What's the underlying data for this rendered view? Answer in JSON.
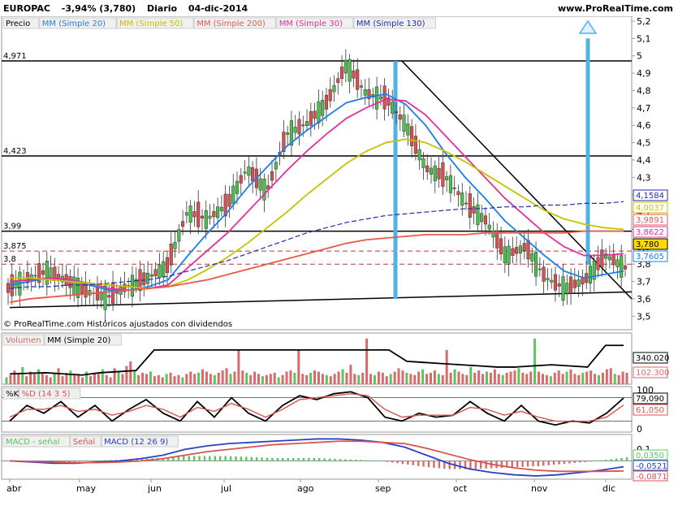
{
  "header": {
    "symbol": "EUROPAC",
    "change": "-3,94% (3,780)",
    "period": "Diario",
    "date": "04-dic-2014",
    "site": "www.ProRealTime.com"
  },
  "colors": {
    "ma20": "#1a7fe8",
    "ma50": "#c8c000",
    "ma200": "#e8594a",
    "ma30": "#e2309a",
    "ma130": "#1f2fb0",
    "volume": "#d96a6a",
    "volume_up": "#5cc45c",
    "k_line": "#000000",
    "d_line": "#d9534f",
    "macd": "#2840c8",
    "signal": "#d9534f",
    "hist_pos": "#5cc45c",
    "hist_neg": "#d96a6a",
    "blue_bar": "#4fb3e8",
    "candle_up": "#4cbf4c",
    "candle_down": "#d95050"
  },
  "price_legend": {
    "items": [
      "Precio",
      "MM (Simple 20)",
      "MM (Simple 50)",
      "MM (Simple 200)",
      "MM (Simple 30)",
      "MM (Simple 130)"
    ]
  },
  "price_note": "© ProRealTime.com Históricos ajustados con dividendos",
  "volume_legend": {
    "items": [
      "Volumen",
      "MM (Simple 20)"
    ]
  },
  "stoch_legend": {
    "items": [
      "%K",
      "%D (14 3 5)"
    ]
  },
  "macd_legend": {
    "items": [
      "MACD - señal",
      "Señal",
      "MACD (12 26 9)"
    ]
  },
  "chart_data": [
    {
      "panel": "price",
      "type": "line",
      "title": "EUROPAC",
      "x": [
        "abr",
        "may",
        "jun",
        "jul",
        "ago",
        "sep",
        "oct",
        "nov",
        "dic"
      ],
      "ylim": [
        3.45,
        5.2
      ],
      "y_ticks": [
        "5,2",
        "5,1",
        "5",
        "4,9",
        "4,8",
        "4,7",
        "4,6",
        "4,5",
        "4,4",
        "4,3",
        "4,2",
        "4,1",
        "4",
        "3,9",
        "3,8",
        "3,7",
        "3,6",
        "3,5"
      ],
      "levels": [
        {
          "label": "4,971",
          "value": 4.971
        },
        {
          "label": "4,423",
          "value": 4.423
        },
        {
          "label": "3,99",
          "value": 3.99
        },
        {
          "label": "3,875",
          "value": 3.875
        },
        {
          "label": "3,8",
          "value": 3.8
        }
      ],
      "value_tags": [
        {
          "label": "4,1584",
          "value": 4.1584,
          "series": "ma130"
        },
        {
          "label": "4,0037",
          "value": 4.0037,
          "series": "ma50"
        },
        {
          "label": "3,9891",
          "value": 3.9891,
          "series": "ma200"
        },
        {
          "label": "3,8622",
          "value": 3.8622,
          "series": "ma30"
        },
        {
          "label": "3,780",
          "value": 3.78,
          "series": "price"
        },
        {
          "label": "3,7605",
          "value": 3.7605,
          "series": "ma20"
        }
      ],
      "series": [
        {
          "name": "Precio",
          "values": [
            3.66,
            3.72,
            3.76,
            3.7,
            3.64,
            3.61,
            3.67,
            3.72,
            3.79,
            4.1,
            4.06,
            4.14,
            4.35,
            4.22,
            4.55,
            4.61,
            4.73,
            4.95,
            4.78,
            4.75,
            4.6,
            4.35,
            4.3,
            4.15,
            4.05,
            3.85,
            3.9,
            3.72,
            3.66,
            3.71,
            3.85,
            3.78
          ]
        },
        {
          "name": "MM (Simple 20)",
          "values": [
            3.68,
            3.7,
            3.72,
            3.71,
            3.68,
            3.65,
            3.65,
            3.67,
            3.71,
            3.85,
            3.98,
            4.1,
            4.24,
            4.36,
            4.48,
            4.57,
            4.65,
            4.73,
            4.76,
            4.78,
            4.72,
            4.6,
            4.44,
            4.3,
            4.18,
            4.05,
            3.95,
            3.85,
            3.76,
            3.72,
            3.74,
            3.76
          ]
        },
        {
          "name": "MM (Simple 30)",
          "values": [
            3.7,
            3.71,
            3.72,
            3.71,
            3.69,
            3.66,
            3.65,
            3.66,
            3.68,
            3.78,
            3.88,
            3.98,
            4.1,
            4.22,
            4.34,
            4.45,
            4.55,
            4.64,
            4.7,
            4.75,
            4.74,
            4.66,
            4.54,
            4.42,
            4.3,
            4.18,
            4.08,
            3.98,
            3.9,
            3.85,
            3.85,
            3.86
          ]
        },
        {
          "name": "MM (Simple 50)",
          "values": [
            3.72,
            3.72,
            3.71,
            3.7,
            3.69,
            3.68,
            3.67,
            3.66,
            3.67,
            3.71,
            3.77,
            3.84,
            3.92,
            4.01,
            4.1,
            4.2,
            4.29,
            4.38,
            4.45,
            4.5,
            4.52,
            4.5,
            4.45,
            4.39,
            4.32,
            4.25,
            4.18,
            4.11,
            4.06,
            4.03,
            4.01,
            4.0
          ]
        },
        {
          "name": "MM (Simple 130)",
          "values": [
            3.66,
            3.67,
            3.67,
            3.68,
            3.68,
            3.69,
            3.7,
            3.71,
            3.73,
            3.76,
            3.79,
            3.82,
            3.86,
            3.9,
            3.94,
            3.98,
            4.01,
            4.04,
            4.06,
            4.08,
            4.09,
            4.1,
            4.11,
            4.12,
            4.12,
            4.13,
            4.13,
            4.14,
            4.14,
            4.15,
            4.15,
            4.16
          ]
        },
        {
          "name": "MM (Simple 200)",
          "values": [
            3.58,
            3.6,
            3.61,
            3.62,
            3.63,
            3.64,
            3.65,
            3.66,
            3.67,
            3.69,
            3.71,
            3.74,
            3.77,
            3.8,
            3.83,
            3.86,
            3.89,
            3.92,
            3.94,
            3.95,
            3.96,
            3.97,
            3.97,
            3.97,
            3.98,
            3.98,
            3.98,
            3.98,
            3.98,
            3.99,
            3.99,
            3.99
          ]
        }
      ]
    },
    {
      "panel": "volume",
      "type": "bar",
      "value_tags": [
        {
          "label": "340.020",
          "value": 340020
        },
        {
          "label": "102.300",
          "value": 102300
        }
      ],
      "values": [
        60,
        80,
        120,
        90,
        150,
        70,
        110,
        90,
        130,
        100,
        80,
        60,
        90,
        140,
        70,
        100,
        120,
        80,
        90,
        60,
        110,
        70,
        100,
        90,
        130,
        80,
        60,
        140,
        110,
        90,
        160,
        200,
        120,
        80,
        100,
        90,
        110,
        70,
        80,
        60,
        90,
        100,
        70,
        80,
        60,
        90,
        110,
        90,
        100,
        130,
        110,
        90,
        80,
        100,
        120,
        140,
        90,
        110,
        300,
        120,
        100,
        80,
        110,
        90,
        70,
        80,
        90,
        100,
        60,
        80,
        110,
        120,
        100,
        300,
        90,
        80,
        100,
        120,
        110,
        90,
        80,
        70,
        90,
        110,
        130,
        100,
        170,
        90,
        80,
        100,
        400,
        90,
        80,
        110,
        100,
        70,
        90,
        110,
        140,
        120,
        100,
        90,
        80,
        110,
        130,
        90,
        100,
        120,
        90,
        80,
        300,
        100,
        130,
        110,
        90,
        80,
        150,
        100,
        120,
        90,
        110,
        100,
        130,
        90,
        80,
        100,
        110,
        120,
        140,
        100,
        90,
        110,
        400,
        110,
        90,
        80,
        70,
        100,
        120,
        90,
        110,
        130,
        90,
        80,
        100,
        110,
        120,
        90,
        80,
        100,
        130,
        140,
        90,
        80,
        110,
        100
      ],
      "ma_values": [
        90,
        95,
        100,
        90,
        80,
        100,
        110,
        120,
        300,
        300,
        300,
        300,
        300,
        300,
        300,
        300,
        300,
        300,
        300,
        300,
        300,
        300,
        200,
        190,
        180,
        170,
        160,
        150,
        150,
        160,
        170,
        160,
        150,
        340,
        340
      ]
    },
    {
      "panel": "stochastic",
      "type": "line",
      "ylim": [
        0,
        100
      ],
      "y_ticks": [
        "100",
        "0"
      ],
      "value_tags": [
        {
          "label": "79,090",
          "value": 79.09
        },
        {
          "label": "61,050",
          "value": 61.05
        }
      ],
      "series": [
        {
          "name": "%K",
          "values": [
            20,
            60,
            40,
            70,
            30,
            60,
            20,
            50,
            75,
            40,
            20,
            70,
            30,
            80,
            40,
            20,
            60,
            85,
            75,
            90,
            95,
            80,
            30,
            20,
            40,
            30,
            35,
            70,
            40,
            20,
            60,
            20,
            10,
            20,
            15,
            40,
            79
          ]
        },
        {
          "name": "%D (14 3 5)",
          "values": [
            30,
            50,
            50,
            60,
            45,
            50,
            35,
            45,
            60,
            50,
            30,
            55,
            45,
            65,
            50,
            30,
            50,
            75,
            80,
            85,
            90,
            85,
            50,
            30,
            35,
            35,
            35,
            55,
            50,
            35,
            45,
            30,
            20,
            18,
            20,
            30,
            61
          ]
        }
      ]
    },
    {
      "panel": "macd",
      "type": "line",
      "value_tags": [
        {
          "label": "0,0350",
          "value": 0.035
        },
        {
          "label": "-0,0521",
          "value": -0.0521
        },
        {
          "label": "-0,0871",
          "value": -0.0871
        }
      ],
      "y_ticks": [
        "0,1",
        "0"
      ],
      "series": [
        {
          "name": "MACD (12 26 9)",
          "values": [
            0.0,
            -0.01,
            -0.02,
            -0.02,
            -0.01,
            0.0,
            0.02,
            0.05,
            0.1,
            0.13,
            0.15,
            0.16,
            0.17,
            0.18,
            0.19,
            0.19,
            0.18,
            0.16,
            0.12,
            0.05,
            -0.02,
            -0.07,
            -0.1,
            -0.12,
            -0.13,
            -0.12,
            -0.1,
            -0.08,
            -0.05
          ]
        },
        {
          "name": "Señal",
          "values": [
            0.0,
            -0.005,
            -0.01,
            -0.015,
            -0.015,
            -0.01,
            0.0,
            0.02,
            0.05,
            0.08,
            0.1,
            0.12,
            0.14,
            0.15,
            0.16,
            0.17,
            0.17,
            0.16,
            0.15,
            0.11,
            0.06,
            0.01,
            -0.03,
            -0.06,
            -0.08,
            -0.09,
            -0.09,
            -0.09,
            -0.087
          ]
        }
      ]
    }
  ]
}
